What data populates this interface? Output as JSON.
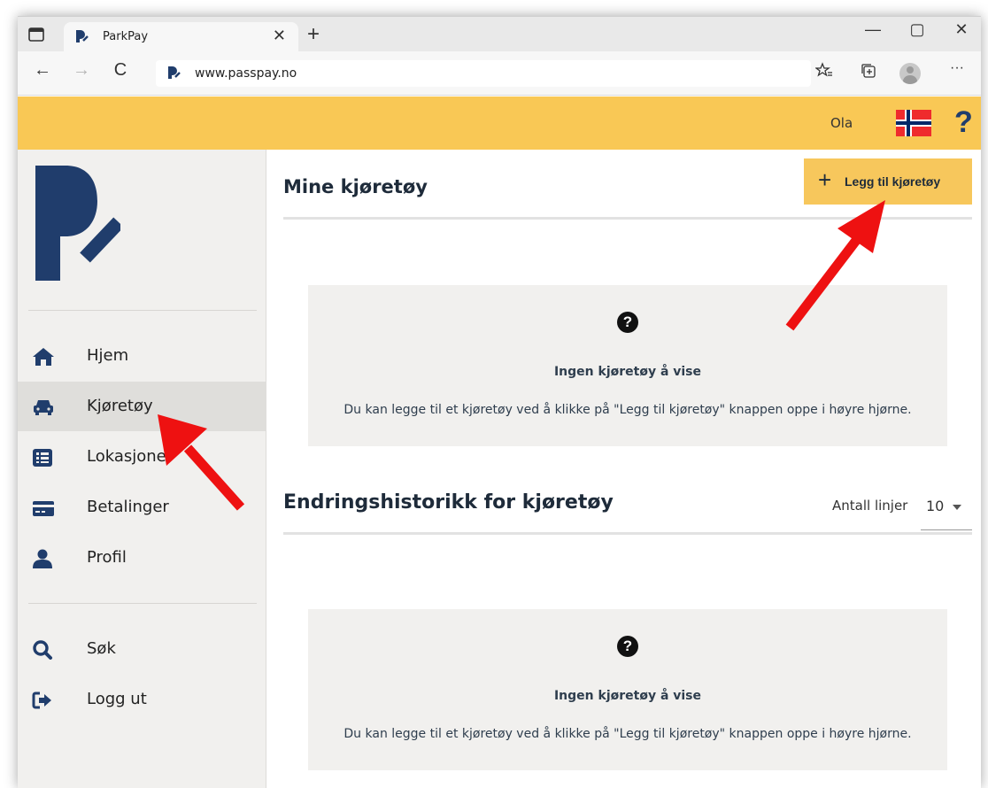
{
  "browser": {
    "tab_title": "ParkPay",
    "url": "www.passpay.no",
    "new_tab_symbol": "+",
    "tab_close_symbol": "✕",
    "window_controls": {
      "minimize": "—",
      "maximize": "▢",
      "close": "✕"
    },
    "nav": {
      "back": "←",
      "forward": "→",
      "refresh": "C"
    },
    "toolbar_icons": [
      "favorites-icon",
      "collections-icon",
      "profile-avatar",
      "more-icon"
    ],
    "more_symbol": "···"
  },
  "header": {
    "username": "Ola",
    "language_flag": "norway-flag-icon",
    "help_symbol": "?",
    "background": "#f9c855"
  },
  "sidebar": {
    "items": [
      {
        "label": "Hjem",
        "icon": "home-icon",
        "active": false
      },
      {
        "label": "Kjøretøy",
        "icon": "car-icon",
        "active": true
      },
      {
        "label": "Lokasjoner",
        "icon": "list-icon",
        "active": false
      },
      {
        "label": "Betalinger",
        "icon": "credit-card-icon",
        "active": false
      },
      {
        "label": "Profil",
        "icon": "user-icon",
        "active": false
      },
      {
        "label": "Søk",
        "icon": "search-icon",
        "active": false
      },
      {
        "label": "Logg ut",
        "icon": "logout-icon",
        "active": false
      }
    ]
  },
  "main": {
    "title": "Mine kjøretøy",
    "add_button": {
      "plus": "+",
      "label": "Legg til kjøretøy"
    },
    "empty_state": {
      "symbol": "?",
      "title": "Ingen kjøretøy å vise",
      "text": "Du kan legge til et kjøretøy ved å klikke på \"Legg til kjøretøy\" knappen oppe i høyre hjørne."
    },
    "history": {
      "title": "Endringshistorikk for kjøretøy",
      "lines_label": "Antall linjer",
      "lines_value": "10",
      "empty_state": {
        "symbol": "?",
        "title": "Ingen kjøretøy å vise",
        "text": "Du kan legge til et kjøretøy ved å klikke på \"Legg til kjøretøy\" knappen oppe i høyre hjørne."
      }
    }
  },
  "colors": {
    "accent": "#f7c75c",
    "brand_navy": "#203d6c",
    "annotation_arrow": "#ee1111"
  }
}
